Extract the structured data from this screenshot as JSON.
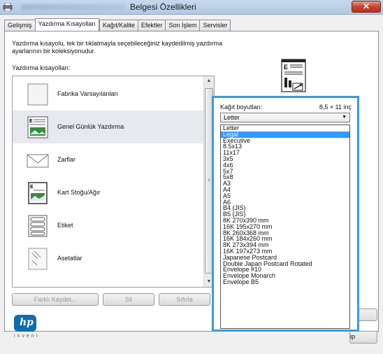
{
  "window": {
    "title": "Belgesi Özellikleri",
    "close_glyph": "✕"
  },
  "tabs": [
    {
      "label": "Gelişmiş"
    },
    {
      "label": "Yazdırma Kısayolları"
    },
    {
      "label": "Kağıt/Kalite"
    },
    {
      "label": "Efektler"
    },
    {
      "label": "Son İşlem"
    },
    {
      "label": "Servisler"
    }
  ],
  "description": "Yazdırma kısayolu, tek bir tıklatmayla seçebileceğiniz kaydedilmiş yazdırma ayarlarının bir koleksiyonudur.",
  "list_label": "Yazdırma kısayolları:",
  "shortcuts": [
    {
      "label": "Fabrika Varsayılanları",
      "icon": "blank-page-icon"
    },
    {
      "label": "Genel Günlük Yazdırma",
      "icon": "document-page-icon"
    },
    {
      "label": "Zarflar",
      "icon": "envelope-icon"
    },
    {
      "label": "Kart Stoğu/Ağır",
      "icon": "card-stock-icon"
    },
    {
      "label": "Etiket",
      "icon": "labels-icon"
    },
    {
      "label": "Asetatlar",
      "icon": "transparency-icon"
    }
  ],
  "buttons": {
    "save_as": "Farklı Kaydet...",
    "delete": "Sil",
    "reset": "Sıfırla"
  },
  "logo": {
    "letters": "hp",
    "tagline": "invent"
  },
  "paper": {
    "label": "Kağıt boyutları:",
    "size": "8,5 × 11 inç",
    "selected": "Letter",
    "options": [
      "Letter",
      "Legal",
      "Executive",
      "8.5x13",
      "11x17",
      "3x5",
      "4x6",
      "5x7",
      "5x8",
      "A3",
      "A4",
      "A5",
      "A6",
      "B4 (JIS)",
      "B5 (JIS)",
      "8K 270x390 mm",
      "16K 195x270 mm",
      "8K 260x368 mm",
      "16K 184x260 mm",
      "8K 273x394 mm",
      "16K 197x273 mm",
      "Japanese Postcard",
      "Double Japan Postcard Rotated",
      "Envelope #10",
      "Envelope Monarch",
      "Envelope B5"
    ],
    "highlighted": "Legal"
  },
  "side_buttons": [
    "m",
    "ip"
  ],
  "colors": {
    "accent": "#3a9be0",
    "highlight": "#3399ff",
    "close": "#c7442c"
  }
}
